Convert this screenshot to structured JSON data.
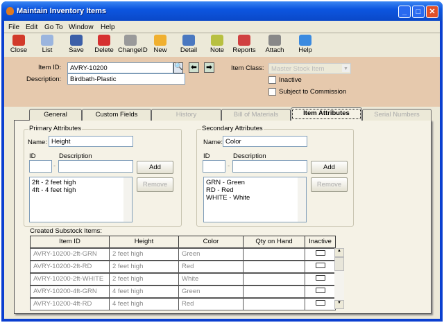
{
  "window": {
    "title": "Maintain Inventory Items",
    "buttons": [
      "minimize",
      "maximize",
      "close"
    ]
  },
  "menu": [
    "File",
    "Edit",
    "Go To",
    "Window",
    "Help"
  ],
  "toolbar": [
    {
      "label": "Close",
      "icon": "close-icon",
      "color": "#d23a2a"
    },
    {
      "label": "List",
      "icon": "list-icon",
      "color": "#9bb5de"
    },
    {
      "label": "Save",
      "icon": "save-icon",
      "color": "#3c5fa8"
    },
    {
      "label": "Delete",
      "icon": "delete-icon",
      "color": "#d63030"
    },
    {
      "label": "ChangeID",
      "icon": "change-id-icon",
      "color": "#9a9a9a"
    },
    {
      "label": "New",
      "icon": "new-icon",
      "color": "#f0b030"
    },
    {
      "label": "Detail",
      "icon": "detail-icon",
      "color": "#4a78c0"
    },
    {
      "label": "Note",
      "icon": "note-icon",
      "color": "#b8c040"
    },
    {
      "label": "Reports",
      "icon": "reports-icon",
      "color": "#d04040"
    },
    {
      "label": "Attach",
      "icon": "attach-icon",
      "color": "#888888"
    },
    {
      "label": "Help",
      "icon": "help-icon",
      "color": "#3a8ae0"
    }
  ],
  "header": {
    "item_id_label": "Item ID:",
    "item_id": "AVRY-10200",
    "description_label": "Description:",
    "description": "Birdbath-Plastic",
    "item_class_label": "Item Class:",
    "item_class": "Master Stock Item",
    "inactive_label": "Inactive",
    "commission_label": "Subject to Commission"
  },
  "tabs": [
    {
      "label": "General",
      "state": "normal"
    },
    {
      "label": "Custom Fields",
      "state": "normal"
    },
    {
      "label": "History",
      "state": "disabled"
    },
    {
      "label": "Bill of Materials",
      "state": "disabled"
    },
    {
      "label": "Item Attributes",
      "state": "active"
    },
    {
      "label": "Serial Numbers",
      "state": "disabled"
    }
  ],
  "primary": {
    "title": "Primary Attributes",
    "name_label": "Name:",
    "name": "Height",
    "id_label": "ID",
    "desc_label": "Description",
    "add": "Add",
    "remove": "Remove",
    "items": [
      "2ft - 2 feet high",
      "4ft - 4 feet high"
    ]
  },
  "secondary": {
    "title": "Secondary Attributes",
    "name_label": "Name:",
    "name": "Color",
    "id_label": "ID",
    "desc_label": "Description",
    "add": "Add",
    "remove": "Remove",
    "items": [
      "GRN - Green",
      "RD - Red",
      "WHITE - White"
    ]
  },
  "substock": {
    "title": "Created Substock Items:",
    "columns": [
      "Item ID",
      "Height",
      "Color",
      "Qty on Hand",
      "Inactive"
    ],
    "rows": [
      [
        "AVRY-10200-2ft-GRN",
        "2 feet high",
        "Green",
        ""
      ],
      [
        "AVRY-10200-2ft-RD",
        "2 feet high",
        "Red",
        ""
      ],
      [
        "AVRY-10200-2ft-WHITE",
        "2 feet high",
        "White",
        ""
      ],
      [
        "AVRY-10200-4ft-GRN",
        "4 feet high",
        "Green",
        ""
      ],
      [
        "AVRY-10200-4ft-RD",
        "4 feet high",
        "Red",
        ""
      ]
    ]
  }
}
